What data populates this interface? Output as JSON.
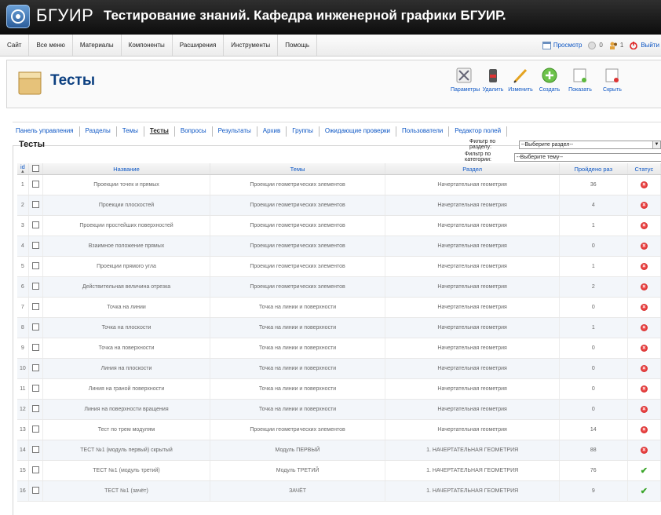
{
  "header": {
    "site_name": "БГУИР",
    "subtitle": "Тестирование знаний. Кафедра инженерной графики БГУИР."
  },
  "menubar": {
    "items": [
      "Сайт",
      "Все меню",
      "Материалы",
      "Компоненты",
      "Расширения",
      "Инструменты",
      "Помощь"
    ],
    "preview": "Просмотр",
    "messages_count": "0",
    "users_count": "1",
    "logout": "Выйти"
  },
  "toolbar": {
    "title": "Тесты",
    "buttons": [
      "Параметры",
      "Удалить",
      "Изменить",
      "Создать",
      "Показать",
      "Скрыть"
    ]
  },
  "submenu": {
    "items": [
      "Панель управления",
      "Разделы",
      "Темы",
      "Тесты",
      "Вопросы",
      "Результаты",
      "Архив",
      "Группы",
      "Ожидающие проверки",
      "Пользователи",
      "Редактор полей"
    ],
    "active": "Тесты"
  },
  "list": {
    "title": "Тесты",
    "filter_section_label": "Фильтр по разделу:",
    "filter_section_value": "--Выберите раздел--",
    "filter_category_label": "Фильтр по категории:",
    "filter_category_value": "--Выберите тему--"
  },
  "columns": {
    "id": "id",
    "name": "Название",
    "theme": "Темы",
    "section": "Раздел",
    "passed": "Пройдено раз",
    "status": "Статус"
  },
  "rows": [
    {
      "id": "1",
      "name": "Проекции точек и прямых",
      "theme": "Проекции геометрических элементов",
      "section": "Начертательная геометрия",
      "passed": "36",
      "status": "unpublished"
    },
    {
      "id": "2",
      "name": "Проекции плоскостей",
      "theme": "Проекции геометрических элементов",
      "section": "Начертательная геометрия",
      "passed": "4",
      "status": "unpublished"
    },
    {
      "id": "3",
      "name": "Проекции простейших поверхностей",
      "theme": "Проекции геометрических элементов",
      "section": "Начертательная геометрия",
      "passed": "1",
      "status": "unpublished"
    },
    {
      "id": "4",
      "name": "Взаимное положение прямых",
      "theme": "Проекции геометрических элементов",
      "section": "Начертательная геометрия",
      "passed": "0",
      "status": "unpublished"
    },
    {
      "id": "5",
      "name": "Проекции прямого угла",
      "theme": "Проекции геометрических элементов",
      "section": "Начертательная геометрия",
      "passed": "1",
      "status": "unpublished"
    },
    {
      "id": "6",
      "name": "Действительная величина отрезка",
      "theme": "Проекции геометрических элементов",
      "section": "Начертательная геометрия",
      "passed": "2",
      "status": "unpublished"
    },
    {
      "id": "7",
      "name": "Точка на линии",
      "theme": "Точка на линии и поверхности",
      "section": "Начертательная геометрия",
      "passed": "0",
      "status": "unpublished"
    },
    {
      "id": "8",
      "name": "Точка на плоскости",
      "theme": "Точка на линии и поверхности",
      "section": "Начертательная геометрия",
      "passed": "1",
      "status": "unpublished"
    },
    {
      "id": "9",
      "name": "Точка на поверхности",
      "theme": "Точка на линии и поверхности",
      "section": "Начертательная геометрия",
      "passed": "0",
      "status": "unpublished"
    },
    {
      "id": "10",
      "name": "Линия на плоскости",
      "theme": "Точка на линии и поверхности",
      "section": "Начертательная геометрия",
      "passed": "0",
      "status": "unpublished"
    },
    {
      "id": "11",
      "name": "Линия на граной поверхности",
      "theme": "Точка на линии и поверхности",
      "section": "Начертательная геометрия",
      "passed": "0",
      "status": "unpublished"
    },
    {
      "id": "12",
      "name": "Линия на поверхности вращения",
      "theme": "Точка на линии и поверхности",
      "section": "Начертательная геометрия",
      "passed": "0",
      "status": "unpublished"
    },
    {
      "id": "13",
      "name": "Тест по трем модулям",
      "theme": "Проекции геометрических элементов",
      "section": "Начертательная геометрия",
      "passed": "14",
      "status": "unpublished"
    },
    {
      "id": "14",
      "name": "ТЕСТ №1 (модуль первый) скрытый",
      "theme": "Модуль ПЕРВЫЙ",
      "section": "1. НАЧЕРТАТЕЛЬНАЯ ГЕОМЕТРИЯ",
      "passed": "88",
      "status": "unpublished"
    },
    {
      "id": "15",
      "name": "ТЕСТ №1 (модуль третий)",
      "theme": "Модуль ТРЕТИЙ",
      "section": "1. НАЧЕРТАТЕЛЬНАЯ ГЕОМЕТРИЯ",
      "passed": "76",
      "status": "published"
    },
    {
      "id": "16",
      "name": "ТЕСТ №1 (зачёт)",
      "theme": "ЗАЧЁТ",
      "section": "1. НАЧЕРТАТЕЛЬНАЯ ГЕОМЕТРИЯ",
      "passed": "9",
      "status": "published"
    }
  ],
  "colors": {
    "link": "#0b55c4",
    "header_bg": "#1a1a1a",
    "status_unpublished": "#c40d0d",
    "status_published": "#3aa52a"
  }
}
